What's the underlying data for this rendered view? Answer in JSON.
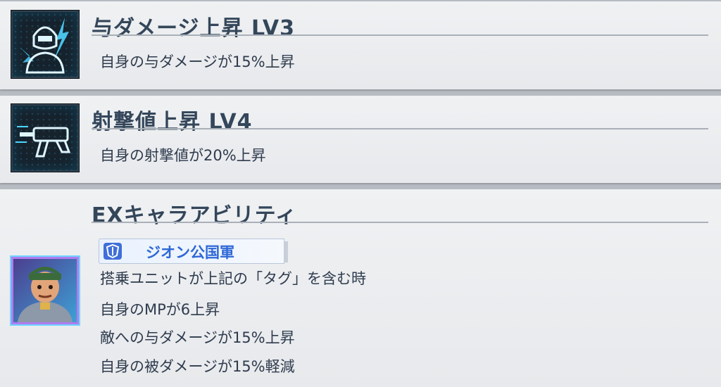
{
  "skills": [
    {
      "title": "与ダメージ上昇 LV3",
      "description": "自身の与ダメージが15%上昇",
      "icon": "pilot-damage-up-icon"
    },
    {
      "title": "射撃値上昇 LV4",
      "description": "自身の射撃値が20%上昇",
      "icon": "beam-rifle-icon"
    }
  ],
  "ex_ability": {
    "title": "EXキャラアビリティ",
    "tag": {
      "label": "ジオン公国軍",
      "icon": "zeon-emblem-icon"
    },
    "lines": [
      "搭乗ユニットが上記の「タグ」を含む時",
      "自身のMPが6上昇",
      "敵への与ダメージが15%上昇",
      "自身の被ダメージが15%軽減"
    ],
    "portrait": "character-portrait"
  },
  "colors": {
    "title_text": "#34465a",
    "body_text": "#2f3b4d",
    "tag_text": "#2e68d6",
    "icon_glow": "#5fd8ff",
    "portrait_border": "#b07cf0"
  }
}
